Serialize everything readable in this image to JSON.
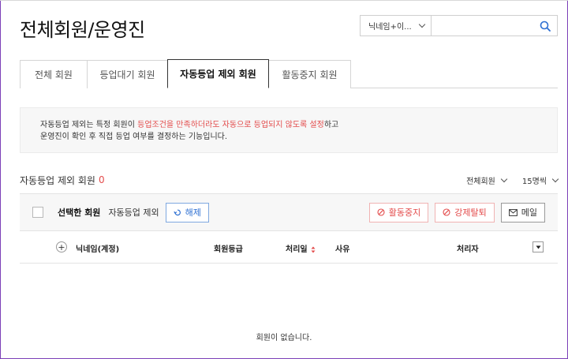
{
  "header": {
    "title": "전체회원/운영진"
  },
  "search": {
    "type_selected": "닉네임+이...",
    "query": "",
    "placeholder": ""
  },
  "tabs": [
    {
      "label": "전체 회원",
      "active": false
    },
    {
      "label": "등업대기 회원",
      "active": false
    },
    {
      "label": "자동등업 제외 회원",
      "active": true
    },
    {
      "label": "활동중지 회원",
      "active": false
    }
  ],
  "info": {
    "line1_prefix": "자동등업 제외는 특정 회원이 ",
    "line1_highlight": "등업조건을 만족하더라도 자동으로 등업되지 않도록 설정",
    "line1_suffix": "하고",
    "line2": "운영진이 확인 후 직접 등업 여부를 결정하는 기능입니다."
  },
  "list": {
    "label": "자동등업 제외 회원",
    "count": "0",
    "filter_member": "전체회원",
    "filter_per_page": "15명씩"
  },
  "actions": {
    "selected_label": "선택한 회원",
    "selected_sub": "자동등업 제외",
    "release_label": "해제",
    "suspend_label": "활동중지",
    "expel_label": "강제탈퇴",
    "mail_label": "메일"
  },
  "table": {
    "columns": [
      "닉네임(계정)",
      "회원등급",
      "처리일",
      "사유",
      "처리자"
    ],
    "empty_message": "회원이 없습니다."
  },
  "colors": {
    "accent_red": "#e34b4b",
    "accent_blue": "#2d6fd2",
    "frame": "#7c3fb8"
  },
  "icons": [
    "search-icon",
    "chevron-down-icon",
    "undo-icon",
    "ban-icon",
    "mail-icon",
    "plus-icon",
    "sort-icon",
    "caret-down-icon"
  ]
}
